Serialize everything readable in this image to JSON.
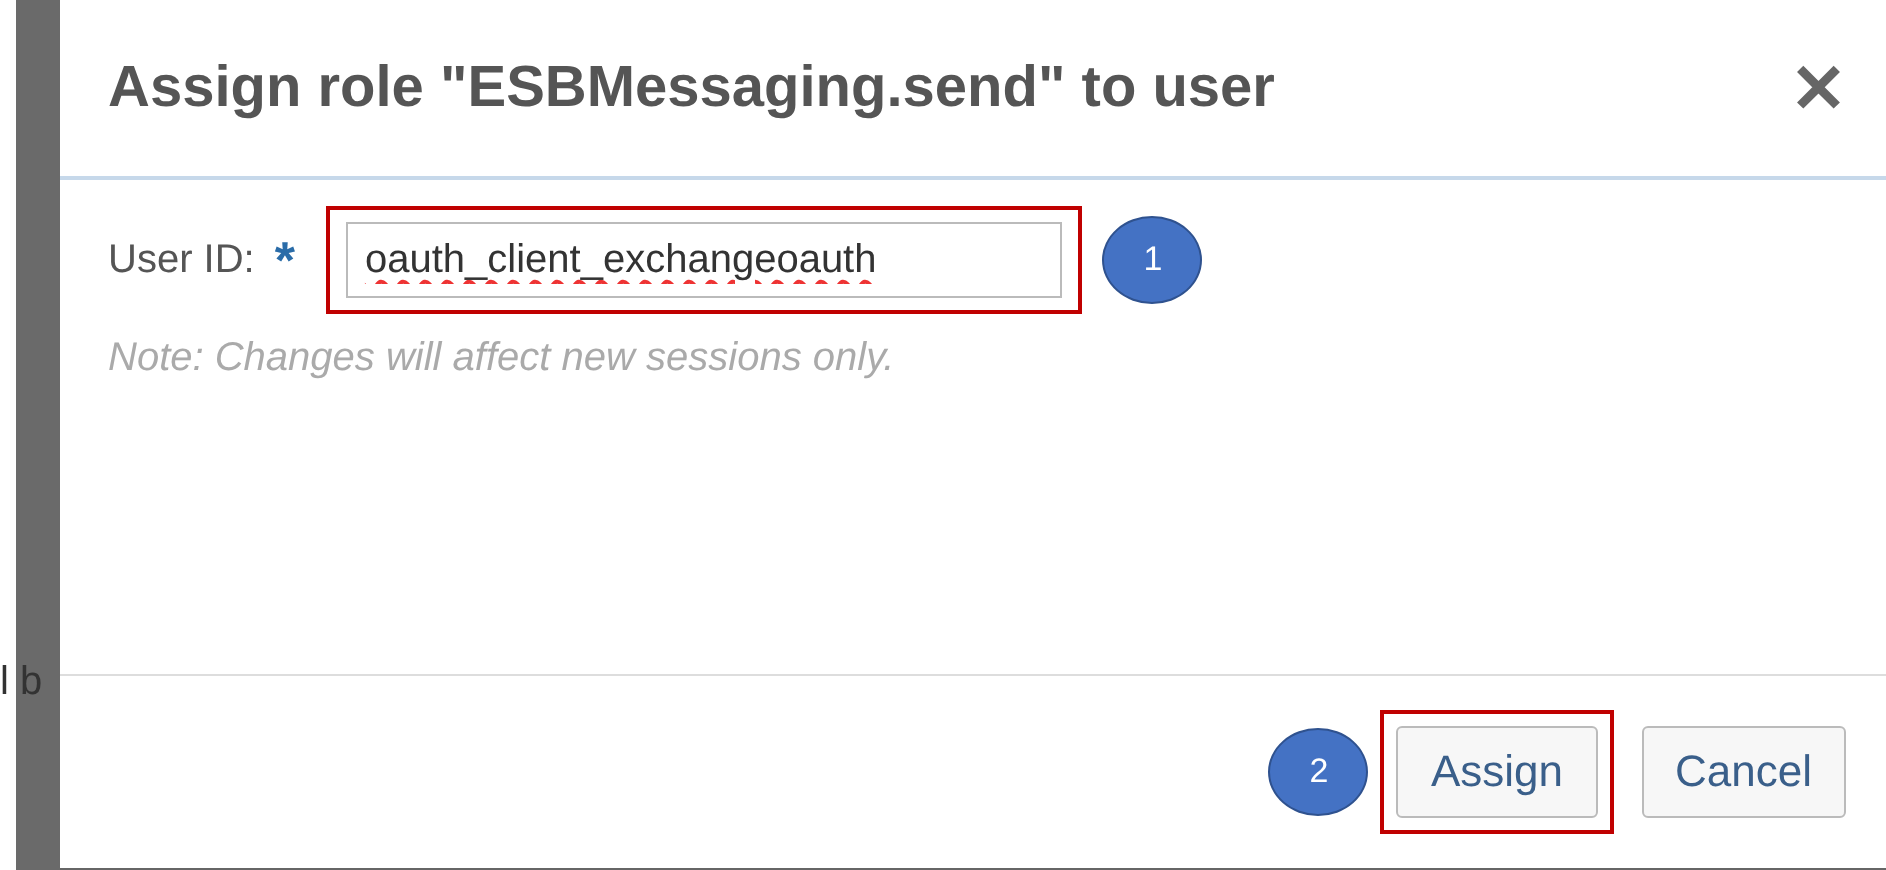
{
  "background": {
    "fragment_text": "l b"
  },
  "dialog": {
    "title": "Assign role \"ESBMessaging.send\" to user",
    "close": "✕",
    "field": {
      "label": "User ID:",
      "required_mark": "*",
      "value": "oauth_client_exchangeoauth",
      "highlighted": true,
      "callout": "1"
    },
    "note": "Note: Changes will affect new sessions only.",
    "buttons": [
      {
        "label": "Assign",
        "highlighted": true,
        "callout": "2"
      },
      {
        "label": "Cancel",
        "highlighted": false
      }
    ]
  }
}
